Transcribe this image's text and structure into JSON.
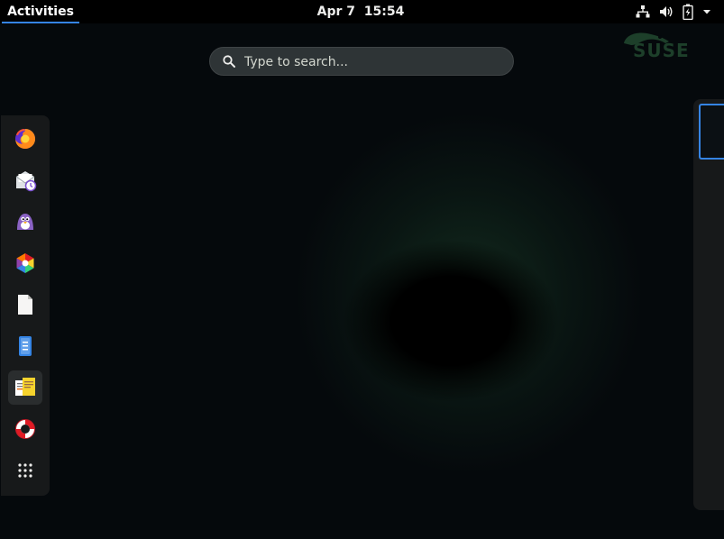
{
  "topbar": {
    "activities_label": "Activities",
    "date": "Apr 7",
    "time": "15:54",
    "tray_icons": [
      "network-wired-icon",
      "volume-icon",
      "battery-icon",
      "system-menu-arrow-icon"
    ]
  },
  "search": {
    "placeholder": "Type to search...",
    "value": ""
  },
  "wallpaper": {
    "logo_text": "SUSE"
  },
  "dash": {
    "items": [
      {
        "name": "Firefox",
        "icon": "firefox-icon",
        "running": false
      },
      {
        "name": "Evolution",
        "icon": "evolution-mail-calendar-icon",
        "running": false
      },
      {
        "name": "Pidgin",
        "icon": "pidgin-icon",
        "running": false
      },
      {
        "name": "Software",
        "icon": "software-hexagon-icon",
        "running": false
      },
      {
        "name": "Document",
        "icon": "document-icon",
        "running": false
      },
      {
        "name": "Files",
        "icon": "files-icon",
        "running": false
      },
      {
        "name": "Text Editor",
        "icon": "editor-icon",
        "running": true
      },
      {
        "name": "Help",
        "icon": "help-lifebuoy-icon",
        "running": false
      },
      {
        "name": "Show Applications",
        "icon": "app-grid-icon",
        "running": false
      }
    ]
  },
  "colors": {
    "accent": "#3584e4",
    "topbar": "#000000",
    "dash_bg": "#17191a",
    "wallpaper": "#05090c"
  }
}
